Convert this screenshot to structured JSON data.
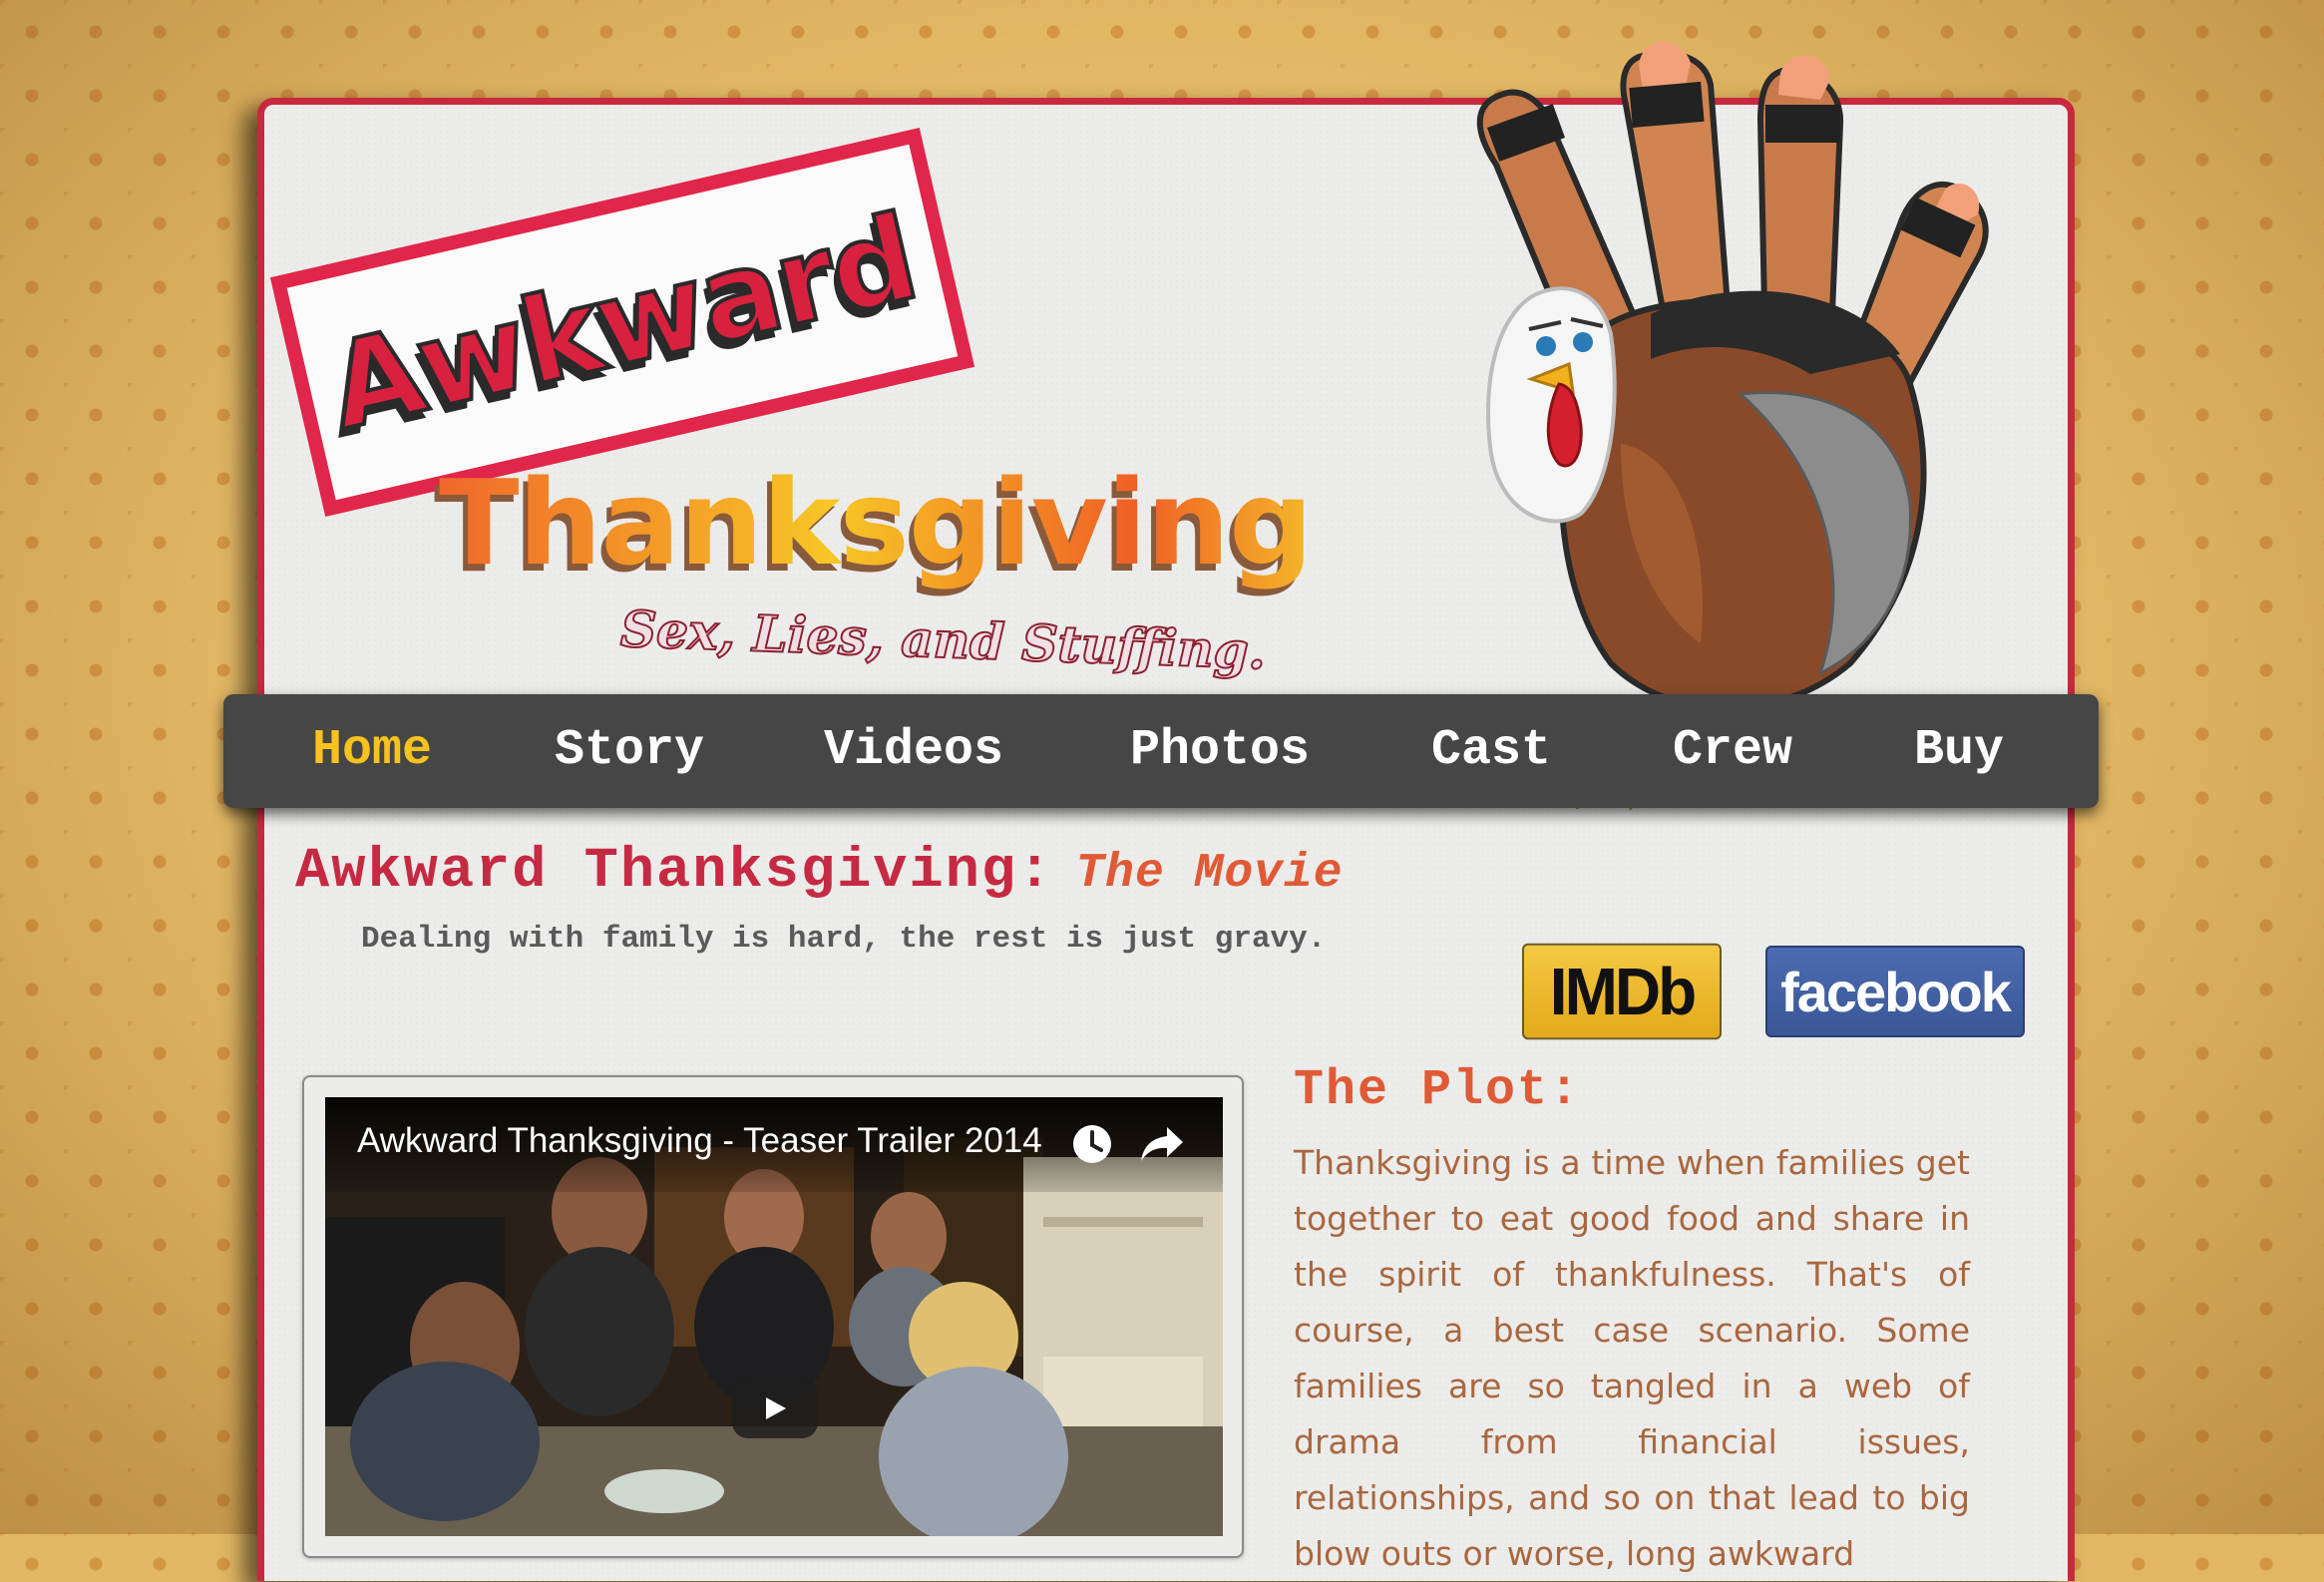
{
  "logo": {
    "word1": "Awkward",
    "word2": "Thanksgiving",
    "tagline": "Sex, Lies, and Stuffing."
  },
  "nav": {
    "items": [
      {
        "label": "Home",
        "active": true
      },
      {
        "label": "Story",
        "active": false
      },
      {
        "label": "Videos",
        "active": false
      },
      {
        "label": "Photos",
        "active": false
      },
      {
        "label": "Cast",
        "active": false
      },
      {
        "label": "Crew",
        "active": false
      },
      {
        "label": "Buy",
        "active": false
      }
    ]
  },
  "header": {
    "title": "Awkward Thanksgiving:",
    "title_suffix": "The Movie",
    "subtitle": "Dealing with family is hard, the rest is just gravy."
  },
  "social": {
    "imdb_label": "IMDb",
    "facebook_label": "facebook"
  },
  "video": {
    "title": "Awkward Thanksgiving - Teaser Trailer 2014"
  },
  "plot": {
    "heading": "The Plot:",
    "body": "Thanksgiving is a time when families get together to eat good food and share in the spirit of thankfulness. That's of course, a best case scenario. Some families are so tangled in a web of drama from financial issues, relationships, and so on that lead to big blow outs or worse, long awkward"
  },
  "colors": {
    "accent_red": "#c9283f",
    "nav_bg": "#464646",
    "nav_active": "#f6c21c",
    "plot_heading": "#e05a36",
    "plot_text": "#a9673f"
  }
}
